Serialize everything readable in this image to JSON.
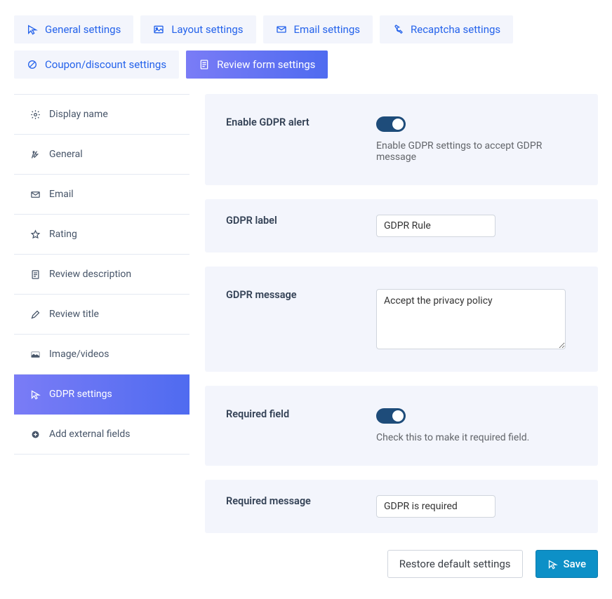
{
  "top_tabs": [
    {
      "label": "General settings"
    },
    {
      "label": "Layout settings"
    },
    {
      "label": "Email settings"
    },
    {
      "label": "Recaptcha settings"
    },
    {
      "label": "Coupon/discount settings"
    },
    {
      "label": "Review form settings",
      "active": true
    }
  ],
  "sidebar": [
    {
      "label": "Display name"
    },
    {
      "label": "General"
    },
    {
      "label": "Email"
    },
    {
      "label": "Rating"
    },
    {
      "label": "Review description"
    },
    {
      "label": "Review title"
    },
    {
      "label": "Image/videos"
    },
    {
      "label": "GDPR settings",
      "active": true
    },
    {
      "label": "Add external fields"
    }
  ],
  "fields": {
    "enable_gdpr": {
      "label": "Enable GDPR alert",
      "helper": "Enable GDPR settings to accept GDPR message",
      "on": true
    },
    "gdpr_label": {
      "label": "GDPR label",
      "value": "GDPR Rule"
    },
    "gdpr_message": {
      "label": "GDPR message",
      "value": "Accept the privacy policy"
    },
    "required_field": {
      "label": "Required field",
      "helper": "Check this to make it required field.",
      "on": true
    },
    "required_message": {
      "label": "Required message",
      "value": "GDPR is required"
    }
  },
  "buttons": {
    "restore": "Restore default settings",
    "save": "Save"
  }
}
